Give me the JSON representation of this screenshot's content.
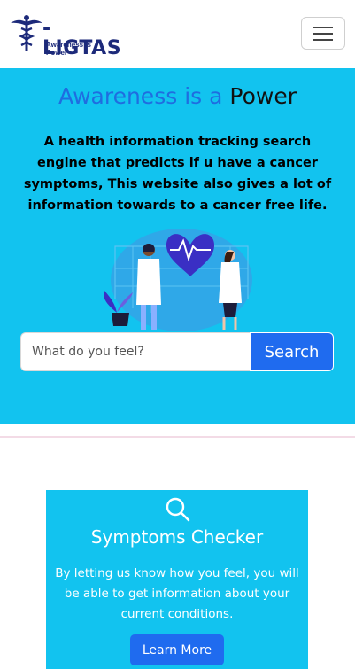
{
  "navbar": {
    "brand": "-LIGTAS",
    "tagline": "Awareness is Power",
    "toggler_icon": "hamburger-icon"
  },
  "hero": {
    "title_part1": "Awareness is a",
    "title_part2": "Power",
    "description": "A health information tracking search engine that predicts if u have a cancer symptoms, This website also gives a lot of information towards to a cancer free life.",
    "search_placeholder": "What do you feel?",
    "search_button": "Search",
    "colors": {
      "background": "#12c3ef",
      "accent": "#1f6bef",
      "title_blue": "#1f6de0"
    }
  },
  "card": {
    "icon": "search-icon",
    "title": "Symptoms Checker",
    "description": "By letting us know how you feel, you will be able to get information about your current conditions.",
    "button": "Learn More"
  }
}
